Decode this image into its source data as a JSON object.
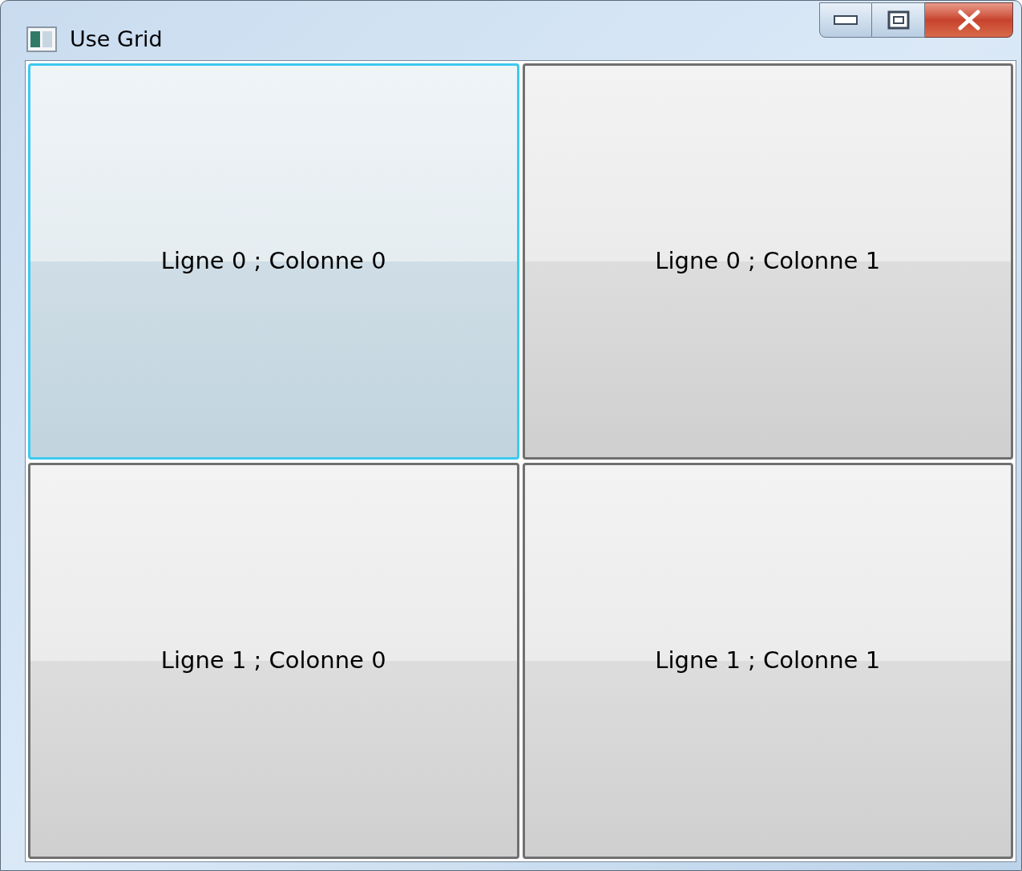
{
  "window": {
    "title": "Use Grid"
  },
  "buttons": [
    {
      "label": "Ligne 0 ; Colonne 0",
      "focused": true
    },
    {
      "label": "Ligne 0 ; Colonne 1",
      "focused": false
    },
    {
      "label": "Ligne 1 ; Colonne 0",
      "focused": false
    },
    {
      "label": "Ligne 1 ; Colonne 1",
      "focused": false
    }
  ]
}
